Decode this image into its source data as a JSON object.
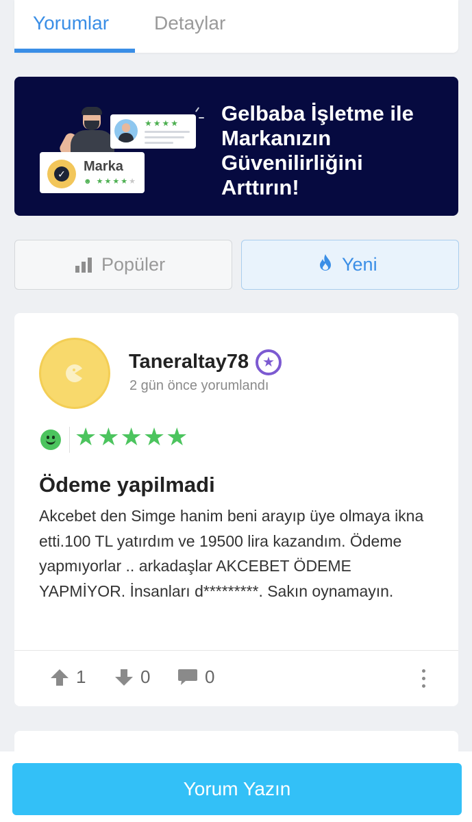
{
  "tabs": [
    {
      "label": "Yorumlar",
      "active": true
    },
    {
      "label": "Detaylar",
      "active": false
    }
  ],
  "banner": {
    "title_lines": [
      "Gelbaba İşletme ile",
      "Markanızın",
      "Güvenilirliğini",
      "Arttırın!"
    ],
    "brand_label": "Marka",
    "background_color": "#060a40"
  },
  "filters": {
    "popular_label": "Popüler",
    "popular_icon": "bar-chart-icon",
    "new_label": "Yeni",
    "new_icon": "flame-icon",
    "selected": "Yeni"
  },
  "review": {
    "username": "Taneraltay78",
    "time": "2 gün önce yorumlandı",
    "rating": 5,
    "rating_max": 5,
    "title": "Ödeme yapilmadi",
    "body": "Akcebet den Simge hanim beni arayıp üye olmaya ikna etti.100 TL yatırdım ve 19500 lira kazandım. Ödeme yapmıyorlar .. arkadaşlar AKCEBET ÖDEME YAPMİYOR. İnsanları d*********. Sakın oynamayın.",
    "upvotes": "1",
    "downvotes": "0",
    "comments": "0"
  },
  "cta": {
    "label": "Yorum Yazın"
  },
  "colors": {
    "accent": "#3a8ee6",
    "rating_green": "#4cc45e",
    "cta_blue": "#33c0f7",
    "badge_purple": "#7c5ad1"
  }
}
